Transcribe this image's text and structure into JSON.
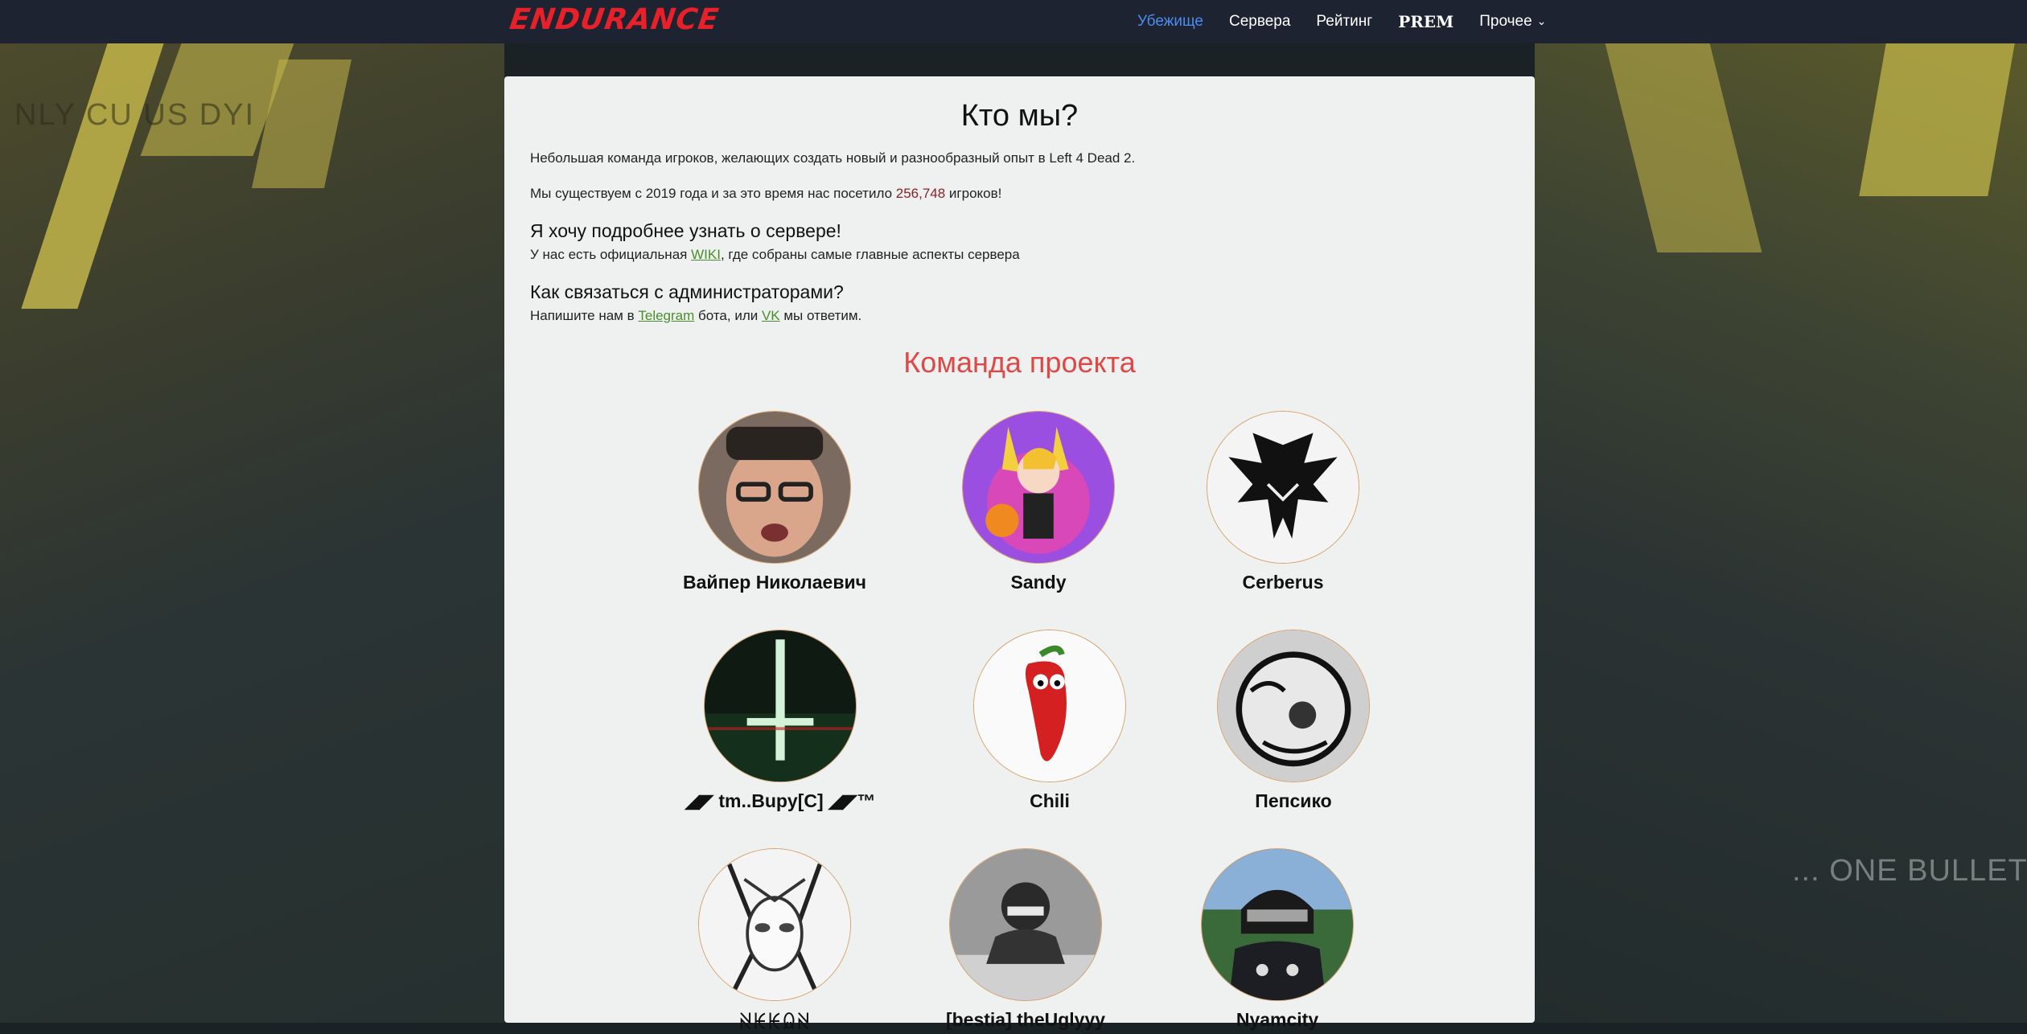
{
  "navbar": {
    "brand": "ENDURANCE",
    "items": [
      {
        "label": "Убежище",
        "active": true
      },
      {
        "label": "Сервера",
        "active": false
      },
      {
        "label": "Рейтинг",
        "active": false
      },
      {
        "label": "PREM",
        "active": false
      },
      {
        "label": "Прочее",
        "active": false,
        "icon": "chevron-down-icon"
      }
    ]
  },
  "background": {
    "caption_left": "NLY CU  US DYI",
    "caption_right": "... ONE BULLET AT A"
  },
  "about": {
    "title": "Кто мы?",
    "intro": "Небольшая команда игроков, желающих создать новый и разнообразный опыт в Left 4 Dead 2.",
    "visits_before": "Мы существуем с 2019 года и за это время нас посетило ",
    "visits_count": "256,748",
    "visits_after": " игроков!",
    "more_title": "Я хочу подробнее узнать о сервере!",
    "more_before": "У нас есть официальная ",
    "more_link": "WIKI",
    "more_after": ", где собраны самые главные аспекты сервера",
    "contact_title": "Как связаться с администраторами?",
    "contact_before": "Напишите нам в ",
    "contact_link1": "Telegram",
    "contact_middle": " бота, или ",
    "contact_link2": "VK",
    "contact_after": " мы ответим."
  },
  "team": {
    "title": "Команда проекта",
    "members": [
      {
        "name": "Вайпер Николаевич"
      },
      {
        "name": "Sandy"
      },
      {
        "name": "Cerberus"
      },
      {
        "name": "◢◤ tm..Bupy[C] ◢◤™"
      },
      {
        "name": "Chili"
      },
      {
        "name": "Пепсико"
      },
      {
        "name": "ꋊꀘꀘꆰꋊ"
      },
      {
        "name": "[bestia] theUglyyy"
      },
      {
        "name": "Nyamcity"
      }
    ]
  },
  "colors": {
    "navbar_bg": "#1d2330",
    "brand": "#e8202a",
    "nav_active": "#4c8cf0",
    "card_bg": "#eef1ef",
    "team_title": "#e04848",
    "link": "#4a8f2c",
    "visits_count": "#8b2323"
  }
}
